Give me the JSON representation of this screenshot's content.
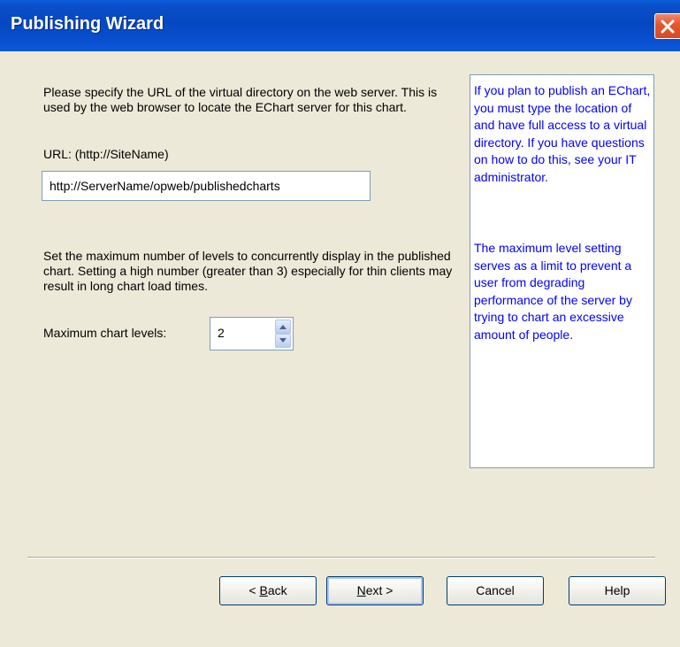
{
  "window": {
    "title": "Publishing Wizard"
  },
  "intro": {
    "text": "Please specify the URL of the virtual directory on the web server. This is used by the web browser to locate the EChart server for this chart."
  },
  "url": {
    "label": "URL: (http://SiteName)",
    "value": "http://ServerName/opweb/publishedcharts"
  },
  "levels": {
    "description": "Set the maximum number of levels to concurrently display in the published chart.  Setting a high number (greater than 3) especially for thin clients may result in long chart load times.",
    "label": "Maximum chart levels:",
    "value": "2"
  },
  "info": {
    "paragraph1": "If you plan to publish an EChart, you must type the location of and have full access to a virtual directory.  If you have questions on how to do this, see your IT administrator.",
    "paragraph2": "The maximum level setting serves as a limit to prevent a user from degrading performance of the server by trying to chart an excessive amount of people."
  },
  "buttons": {
    "back_prefix": "< ",
    "back_mnemonic": "B",
    "back_rest": "ack",
    "next_mnemonic": "N",
    "next_rest": "ext >",
    "cancel": "Cancel",
    "help": "Help"
  },
  "colors": {
    "titlebar": "#0a4fc9",
    "info_text": "#0000ff",
    "dialog_bg": "#ece9d8"
  }
}
